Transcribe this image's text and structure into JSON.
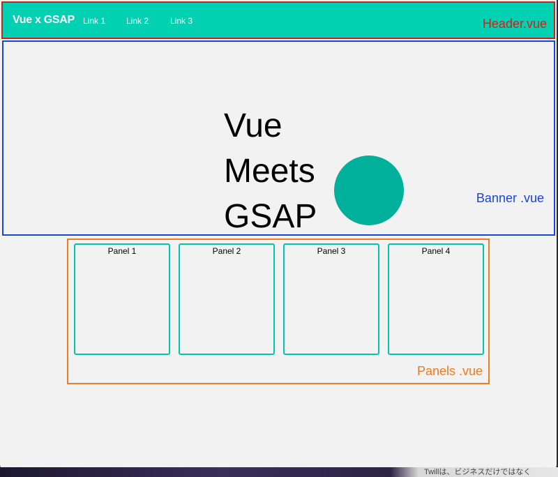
{
  "header": {
    "brand": "Vue x GSAP",
    "links": [
      "Link 1",
      "Link 2",
      "Link 3"
    ],
    "annotation": "Header.vue"
  },
  "banner": {
    "title_lines": [
      "Vue",
      "Meets",
      "GSAP"
    ],
    "annotation": "Banner .vue"
  },
  "panels": {
    "items": [
      "Panel 1",
      "Panel 2",
      "Panel 3",
      "Panel 4"
    ],
    "annotation": "Panels .vue"
  },
  "footer_strip": {
    "text": "Twillは、ビジネスだけではなく"
  },
  "colors": {
    "header_bg": "#00d1b2",
    "header_outline": "#c0281e",
    "banner_outline": "#1a44d8",
    "panels_outline": "#f07b20",
    "panel_border": "#00c6a8",
    "circle": "#00b09b",
    "page_bg": "#f2f2f2"
  }
}
